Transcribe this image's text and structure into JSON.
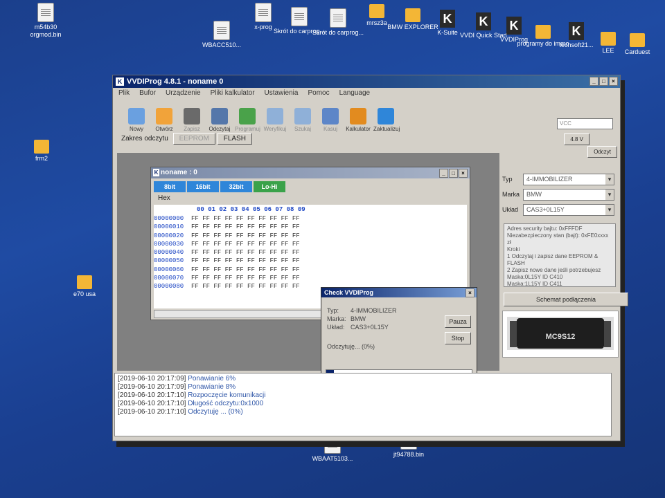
{
  "desktop": {
    "icons": [
      {
        "label": "m54b30 orgmod.bin",
        "kind": "file"
      },
      {
        "label": "WBACC510...",
        "kind": "file"
      },
      {
        "label": "x-prog",
        "kind": "file"
      },
      {
        "label": "Skrót do carprog...",
        "kind": "file"
      },
      {
        "label": "Skrót do carprog...",
        "kind": "file"
      },
      {
        "label": "mrsz3a",
        "kind": "folder"
      },
      {
        "label": "BMW EXPLORER",
        "kind": "folder"
      },
      {
        "label": "K-Suite",
        "kind": "app"
      },
      {
        "label": "VVDI Quick Start",
        "kind": "app"
      },
      {
        "label": "VVDIProg",
        "kind": "app"
      },
      {
        "label": "programy do immo",
        "kind": "folder"
      },
      {
        "label": "techsoft21...",
        "kind": "app"
      },
      {
        "label": "LEE",
        "kind": "folder"
      },
      {
        "label": "Carduest",
        "kind": "folder"
      },
      {
        "label": "frm2",
        "kind": "folder"
      },
      {
        "label": "e70 usa",
        "kind": "folder"
      },
      {
        "label": "WBAAT5103...",
        "kind": "file"
      },
      {
        "label": "jt94788.bin",
        "kind": "file"
      }
    ]
  },
  "window": {
    "title": "VVDIProg 4.8.1 - noname 0",
    "menu": [
      "Plik",
      "Bufor",
      "Urządzenie",
      "Pliki kalkulator",
      "Ustawienia",
      "Pomoc",
      "Language"
    ],
    "toolbar": [
      {
        "label": "Nowy",
        "color": "#6aa0e0",
        "enabled": true
      },
      {
        "label": "Otwórz",
        "color": "#f1a33a",
        "enabled": true
      },
      {
        "label": "Zapisz",
        "color": "#6a6a6a",
        "enabled": false
      },
      {
        "label": "Odczytaj",
        "color": "#5577aa",
        "enabled": true
      },
      {
        "label": "Programuj",
        "color": "#4aa24a",
        "enabled": false
      },
      {
        "label": "Weryfikuj",
        "color": "#8fb0d8",
        "enabled": false
      },
      {
        "label": "Szukaj",
        "color": "#8fb0d8",
        "enabled": false
      },
      {
        "label": "Kasuj",
        "color": "#5d86c8",
        "enabled": false
      },
      {
        "label": "Kalkulator",
        "color": "#e28b1f",
        "enabled": true
      },
      {
        "label": "Zaktualizuj",
        "color": "#2f86d9",
        "enabled": true
      }
    ],
    "range_label": "Zakres odczytu",
    "range_buttons": [
      "EEPROM",
      "FLASH"
    ],
    "right_combo": "VCC",
    "ksv_label": "4.8 V",
    "odczyt_button": "Odczyt",
    "panel": {
      "typ_label": "Typ",
      "typ_value": "4-IMMOBILIZER",
      "marka_label": "Marka",
      "marka_value": "BMW",
      "uklad_label": "Układ",
      "uklad_value": "CAS3+0L15Y",
      "info_lines": [
        "Adres security bajtu: 0xFFFDF",
        "Niezabezpieczony stan (bajt): 0xFE0xxxx zł",
        "Kroki",
        "1 Odczytaj i zapisz dane EEPROM & FLASH",
        "2 Zapisz nowe dane jeśli potrzebujesz",
        "Maska:0L15Y ID C410",
        "Maska:1L15Y ID C411"
      ],
      "scheme_button": "Schemat podłączenia",
      "device_label": "MC9S12"
    },
    "log": [
      {
        "ts": "[2019-06-10 20:17:09]",
        "msg": "Ponawianie 6%"
      },
      {
        "ts": "[2019-06-10 20:17:09]",
        "msg": "Ponawianie 8%"
      },
      {
        "ts": "[2019-06-10 20:17:10]",
        "msg": "Rozpoczęcie komunikacji"
      },
      {
        "ts": "[2019-06-10 20:17:10]",
        "msg": "Długość odczytu:0x1000"
      },
      {
        "ts": "[2019-06-10 20:17:10]",
        "msg": "Odczytuję ... (0%)"
      }
    ]
  },
  "hex_window": {
    "title": "noname : 0",
    "tabs": [
      {
        "label": "8bit",
        "color": "#2f86d9"
      },
      {
        "label": "16bit",
        "color": "#2f86d9"
      },
      {
        "label": "32bit",
        "color": "#2f86d9"
      },
      {
        "label": "Lo-Hi",
        "color": "#3aa24a"
      }
    ],
    "mode_label": "Hex",
    "columns": "00 01 02 03 04 05 06 07 08 09",
    "rows": [
      {
        "addr": "00000000",
        "bytes": "FF FF FF FF FF FF FF FF FF FF"
      },
      {
        "addr": "00000010",
        "bytes": "FF FF FF FF FF FF FF FF FF FF"
      },
      {
        "addr": "00000020",
        "bytes": "FF FF FF FF FF FF FF FF FF FF"
      },
      {
        "addr": "00000030",
        "bytes": "FF FF FF FF FF FF FF FF FF FF"
      },
      {
        "addr": "00000040",
        "bytes": "FF FF FF FF FF FF FF FF FF FF"
      },
      {
        "addr": "00000050",
        "bytes": "FF FF FF FF FF FF FF FF FF FF"
      },
      {
        "addr": "00000060",
        "bytes": "FF FF FF FF FF FF FF FF FF FF"
      },
      {
        "addr": "00000070",
        "bytes": "FF FF FF FF FF FF FF FF FF FF"
      },
      {
        "addr": "00000080",
        "bytes": "FF FF FF FF FF FF FF FF FF FF"
      }
    ]
  },
  "dialog": {
    "title": "Check VVDIProg",
    "typ_label": "Typ:",
    "typ_value": "4-IMMOBILIZER",
    "marka_label": "Marka:",
    "marka_value": "BMW",
    "uklad_label": "Układ:",
    "uklad_value": "CAS3+0L15Y",
    "status": "Odczytuję... (0%)",
    "pause_button": "Pauza",
    "stop_button": "Stop",
    "progress": 0.05
  }
}
